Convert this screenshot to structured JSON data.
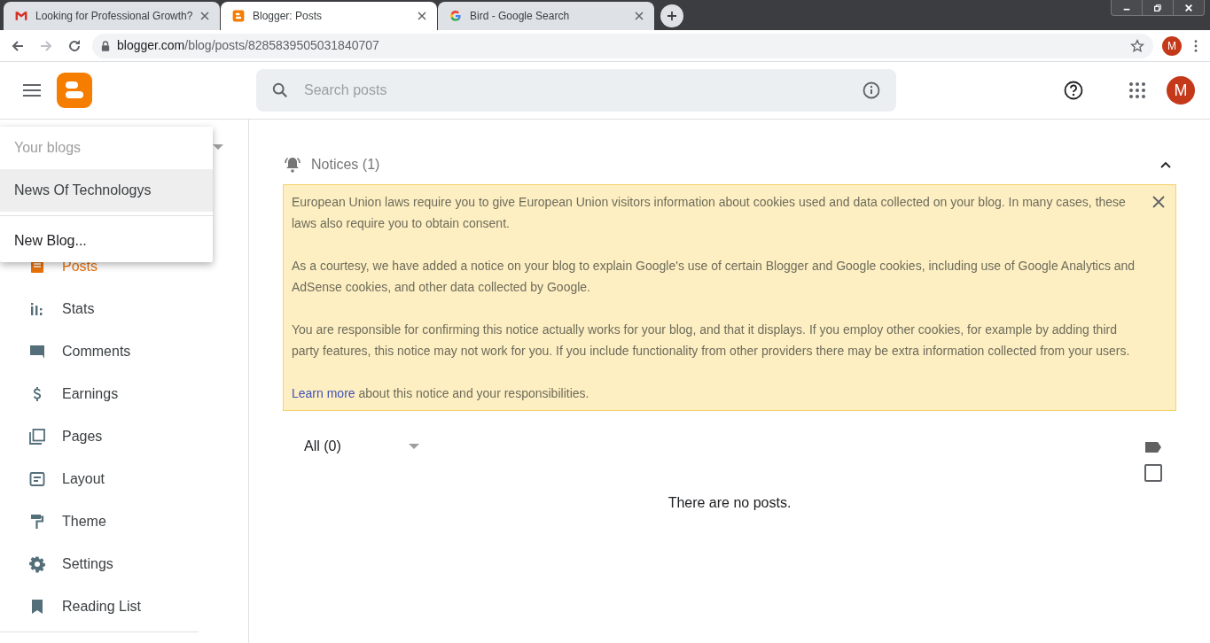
{
  "browser": {
    "tabs": [
      {
        "title": "Looking for Professional Growth?",
        "kind": "gmail",
        "selected": false
      },
      {
        "title": "Blogger: Posts",
        "kind": "blogger",
        "selected": true
      },
      {
        "title": "Bird - Google Search",
        "kind": "google",
        "selected": false
      }
    ],
    "url": {
      "domain": "blogger.com",
      "path": "/blog/posts/8285839505031840707"
    },
    "profile": "M"
  },
  "header": {
    "search": {
      "placeholder": "Search posts"
    },
    "avatar": "M"
  },
  "blog_menu": {
    "heading": "Your blogs",
    "blogs": [
      {
        "name": "News Of Technologys",
        "selected": true
      }
    ],
    "new_blog": "New Blog..."
  },
  "sidebar": {
    "items": [
      {
        "label": "Posts",
        "kind": "posts",
        "selected": true
      },
      {
        "label": "Stats",
        "kind": "stats",
        "selected": false
      },
      {
        "label": "Comments",
        "kind": "comments",
        "selected": false
      },
      {
        "label": "Earnings",
        "kind": "earnings",
        "selected": false
      },
      {
        "label": "Pages",
        "kind": "pages",
        "selected": false
      },
      {
        "label": "Layout",
        "kind": "layout",
        "selected": false
      },
      {
        "label": "Theme",
        "kind": "theme",
        "selected": false
      },
      {
        "label": "Settings",
        "kind": "settings",
        "selected": false
      },
      {
        "label": "Reading List",
        "kind": "reading",
        "selected": false
      }
    ]
  },
  "notices": {
    "title": "Notices (1)",
    "expanded": true,
    "paragraphs": [
      "European Union laws require you to give European Union visitors information about cookies used and data collected on your blog. In many cases, these laws also require you to obtain consent.",
      "As a courtesy, we have added a notice on your blog to explain Google's use of certain Blogger and Google cookies, including use of Google Analytics and AdSense cookies, and other data collected by Google.",
      "You are responsible for confirming this notice actually works for your blog, and that it displays. If you employ other cookies, for example by adding third party features, this notice may not work for you. If you include functionality from other providers there may be extra information collected from your users."
    ],
    "link": "Learn more",
    "link_tail": "about this notice and your responsibilities."
  },
  "posts": {
    "filter": "All (0)",
    "select_all_checked": false,
    "empty_message": "There are no posts."
  }
}
